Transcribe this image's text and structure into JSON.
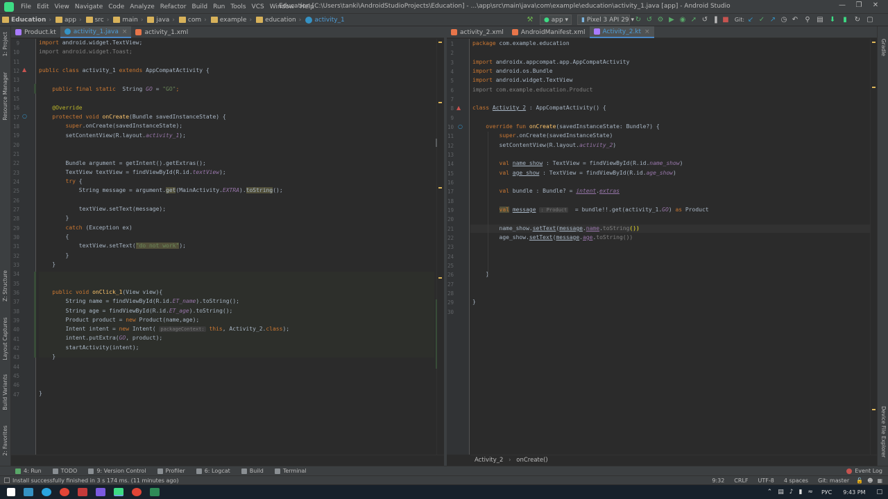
{
  "menu": {
    "items": [
      "File",
      "Edit",
      "View",
      "Navigate",
      "Code",
      "Analyze",
      "Refactor",
      "Build",
      "Run",
      "Tools",
      "VCS",
      "Window",
      "Help"
    ],
    "title": "Education [C:\\Users\\tanki\\AndroidStudioProjects\\Education] - ...\\app\\src\\main\\java\\com\\example\\education\\activity_1.java [app] - Android Studio"
  },
  "breadcrumbs": [
    "Education",
    "app",
    "src",
    "main",
    "java",
    "com",
    "example",
    "education",
    "activity_1"
  ],
  "toolbar": {
    "run_config": "app",
    "device": "Pixel 3 API 29",
    "git_label": "Git:"
  },
  "left_editor": {
    "tabs": [
      {
        "label": "Product.kt"
      },
      {
        "label": "activity_1.java"
      },
      {
        "label": "activity_1.xml"
      }
    ],
    "lines": [
      "9",
      "10",
      "11",
      "12",
      "13",
      "14",
      "15",
      "16",
      "17",
      "18",
      "19",
      "20",
      "21",
      "22",
      "23",
      "24",
      "25",
      "26",
      "27",
      "28",
      "29",
      "30",
      "31",
      "32",
      "33",
      "34",
      "35",
      "36",
      "37",
      "38",
      "39",
      "40",
      "41",
      "42",
      "43",
      "44",
      "45",
      "46",
      "47"
    ],
    "code": {
      "l9a": "import",
      "l9b": " android.widget.TextView;",
      "l10": "import android.widget.Toast;",
      "l12a": "public class",
      "l12b": " activity_1 ",
      "l12c": "extends",
      "l12d": " AppCompatActivity {",
      "l14a": "    public final static  ",
      "l14b": "String ",
      "l14c": "GO",
      "l14d": " = ",
      "l14e": "\"GO\"",
      "l14f": ";",
      "l16": "    @Override",
      "l17a": "    protected void ",
      "l17b": "onCreate",
      "l17c": "(Bundle savedInstanceState) {",
      "l18a": "        super",
      "l18b": ".onCreate(savedInstanceState);",
      "l19a": "        setContentView(R.layout.",
      "l19b": "activity_1",
      "l19c": ");",
      "l22": "        Bundle argument = getIntent().getExtras();",
      "l23a": "        TextView textView = findViewById(R.id.",
      "l23b": "textView",
      "l23c": ");",
      "l24a": "        try",
      "l24b": " {",
      "l25a": "            String message = argument.",
      "l25b": "get",
      "l25c": "(MainActivity.",
      "l25d": "EXTRA",
      "l25e": ").",
      "l25f": "toString",
      "l25g": "();",
      "l27": "            textView.setText(message);",
      "l28": "        }",
      "l29a": "        catch",
      "l29b": " (Exception ex)",
      "l30": "        {",
      "l31a": "            textView.setText(",
      "l31b": "\"do not work\"",
      "l31c": ");",
      "l32": "        }",
      "l33": "    }",
      "l36a": "    public void ",
      "l36b": "onClick_1",
      "l36c": "(View view){",
      "l37a": "        String name = findViewById(R.id.",
      "l37b": "ET_name",
      "l37c": ").toString();",
      "l38a": "        String age = findViewById(R.id.",
      "l38b": "ET_age",
      "l38c": ").toString();",
      "l39a": "        Product product = ",
      "l39b": "new",
      "l39c": " Product(name,age);",
      "l40a": "        Intent intent = ",
      "l40b": "new",
      "l40c": " Intent( ",
      "l40d": "packageContext:",
      "l40e": " this",
      "l40f": ", Activity_2.",
      "l40g": "class",
      "l40h": ");",
      "l41a": "        intent.putExtra(",
      "l41b": "GO",
      "l41c": ", product);",
      "l42": "        startActivity(intent);",
      "l43": "    }",
      "l47": "}"
    }
  },
  "right_editor": {
    "tabs": [
      {
        "label": "activity_2.xml"
      },
      {
        "label": "AndroidManifest.xml"
      },
      {
        "label": "Activity_2.kt"
      }
    ],
    "lines": [
      "1",
      "2",
      "3",
      "4",
      "5",
      "6",
      "7",
      "8",
      "9",
      "10",
      "11",
      "12",
      "13",
      "14",
      "15",
      "16",
      "17",
      "18",
      "19",
      "20",
      "21",
      "22",
      "23",
      "24",
      "25",
      "26",
      "27",
      "28",
      "29",
      "30"
    ],
    "code": {
      "r1a": "package",
      "r1b": " com.example.education",
      "r3a": "import",
      "r3b": " androidx.appcompat.app.AppCompatActivity",
      "r4a": "import",
      "r4b": " android.os.Bundle",
      "r5a": "import",
      "r5b": " android.widget.TextView",
      "r6": "import com.example.education.Product",
      "r8a": "class ",
      "r8b": "Activity_2",
      "r8c": " : AppCompatActivity() {",
      "r10a": "    override fun ",
      "r10b": "onCreate",
      "r10c": "(savedInstanceState: Bundle?) {",
      "r11a": "        super",
      "r11b": ".onCreate(savedInstanceState)",
      "r12a": "        setContentView(R.layout.",
      "r12b": "activity_2",
      "r12c": ")",
      "r14a": "        val ",
      "r14b": "name_show",
      "r14c": " : TextView = findViewById(R.id.",
      "r14d": "name_show",
      "r14e": ")",
      "r15a": "        val ",
      "r15b": "age_show",
      "r15c": " : TextView = findViewById(R.id.",
      "r15d": "age_show",
      "r15e": ")",
      "r17a": "        val ",
      "r17b": "bundle : Bundle? = ",
      "r17c": "intent",
      "r17d": ".",
      "r17e": "extras",
      "r19a": "val",
      "r19b": "message",
      "r19c": ": Product",
      "r19d": "  = bundle!!.get(activity_1.",
      "r19e": "GO",
      "r19f": ") ",
      "r19g": "as",
      "r19h": " Product",
      "r21a": "        name_show.",
      "r21b": "setText",
      "r21c": "(",
      "r21d": "message",
      "r21e": ".",
      "r21f": "name",
      "r21g": ".",
      "r21h": "toString",
      "r21i": "())",
      "r22a": "        age_show.",
      "r22b": "setText",
      "r22c": "(",
      "r22d": "message",
      "r22e": ".",
      "r22f": "age",
      "r22g": ".",
      "r22h": "toString",
      "r22i": "())",
      "r26": "    }",
      "r29": "}"
    },
    "breadcrumb": [
      "Activity_2",
      "onCreate()"
    ]
  },
  "left_strip": [
    "1: Project",
    "Resource Manager",
    "Z: Structure",
    "Layout Captures",
    "Build Variants",
    "2: Favorites"
  ],
  "right_strip": [
    "Gradle",
    "Device File Explorer"
  ],
  "toolwindows": [
    "4: Run",
    "TODO",
    "9: Version Control",
    "Profiler",
    "6: Logcat",
    "Build",
    "Terminal"
  ],
  "event_log": "Event Log",
  "status": {
    "message": "Install successfully finished in 3 s 174 ms. (11 minutes ago)",
    "position": "9:32",
    "line_sep": "CRLF",
    "encoding": "UTF-8",
    "indent": "4 spaces",
    "git": "Git: master"
  },
  "tray": {
    "lang": "РУС",
    "time": "9:43 PM"
  }
}
